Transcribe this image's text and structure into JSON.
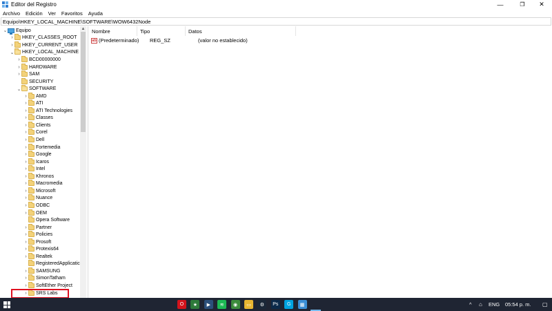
{
  "window": {
    "title": "Editor del Registro",
    "controls": {
      "minimize": "—",
      "maximize": "❐",
      "close": "✕"
    }
  },
  "menu": [
    "Archivo",
    "Edición",
    "Ver",
    "Favoritos",
    "Ayuda"
  ],
  "address": "Equipo\\HKEY_LOCAL_MACHINE\\SOFTWARE\\WOW6432Node",
  "tree": [
    {
      "label": "Equipo",
      "level": 0,
      "expanded": true,
      "icon": "computer-icon"
    },
    {
      "label": "HKEY_CLASSES_ROOT",
      "level": 1,
      "expanded": false
    },
    {
      "label": "HKEY_CURRENT_USER",
      "level": 1,
      "expanded": false
    },
    {
      "label": "HKEY_LOCAL_MACHINE",
      "level": 1,
      "expanded": true
    },
    {
      "label": "BCD00000000",
      "level": 2,
      "expanded": false
    },
    {
      "label": "HARDWARE",
      "level": 2,
      "expanded": false
    },
    {
      "label": "SAM",
      "level": 2,
      "expanded": false
    },
    {
      "label": "SECURITY",
      "level": 2,
      "expanded": null
    },
    {
      "label": "SOFTWARE",
      "level": 2,
      "expanded": true
    },
    {
      "label": "AMD",
      "level": 3,
      "expanded": false
    },
    {
      "label": "ATI",
      "level": 3,
      "expanded": false
    },
    {
      "label": "ATI Technologies",
      "level": 3,
      "expanded": false
    },
    {
      "label": "Classes",
      "level": 3,
      "expanded": false
    },
    {
      "label": "Clients",
      "level": 3,
      "expanded": false
    },
    {
      "label": "Corel",
      "level": 3,
      "expanded": false
    },
    {
      "label": "Dell",
      "level": 3,
      "expanded": false
    },
    {
      "label": "Fortemedia",
      "level": 3,
      "expanded": false
    },
    {
      "label": "Google",
      "level": 3,
      "expanded": false
    },
    {
      "label": "Icaros",
      "level": 3,
      "expanded": false
    },
    {
      "label": "Intel",
      "level": 3,
      "expanded": false
    },
    {
      "label": "Khronos",
      "level": 3,
      "expanded": false
    },
    {
      "label": "Macromedia",
      "level": 3,
      "expanded": false
    },
    {
      "label": "Microsoft",
      "level": 3,
      "expanded": false
    },
    {
      "label": "Nuance",
      "level": 3,
      "expanded": false
    },
    {
      "label": "ODBC",
      "level": 3,
      "expanded": false
    },
    {
      "label": "OEM",
      "level": 3,
      "expanded": false
    },
    {
      "label": "Opera Software",
      "level": 3,
      "expanded": null
    },
    {
      "label": "Partner",
      "level": 3,
      "expanded": false
    },
    {
      "label": "Policies",
      "level": 3,
      "expanded": false
    },
    {
      "label": "Prosoft",
      "level": 3,
      "expanded": false
    },
    {
      "label": "Protexis64",
      "level": 3,
      "expanded": false
    },
    {
      "label": "Realtek",
      "level": 3,
      "expanded": false
    },
    {
      "label": "RegisteredApplicatic",
      "level": 3,
      "expanded": null
    },
    {
      "label": "SAMSUNG",
      "level": 3,
      "expanded": false
    },
    {
      "label": "SimonTatham",
      "level": 3,
      "expanded": false
    },
    {
      "label": "SoftEther Project",
      "level": 3,
      "expanded": false
    },
    {
      "label": "SRS Labs",
      "level": 3,
      "expanded": false
    }
  ],
  "list": {
    "columns": [
      "Nombre",
      "Tipo",
      "Datos"
    ],
    "rows": [
      {
        "name": "(Predeterminado)",
        "type": "REG_SZ",
        "data": "(valor no establecido)",
        "icon_text": "ab"
      }
    ]
  },
  "taskbar": {
    "apps": [
      {
        "name": "opera-icon",
        "color": "#d3131c",
        "glyph": "O"
      },
      {
        "name": "camtasia-icon",
        "color": "#2d7a3a",
        "glyph": "★"
      },
      {
        "name": "media-player-icon",
        "color": "#2b4f7a",
        "glyph": "▶"
      },
      {
        "name": "spotify-icon",
        "color": "#1db954",
        "glyph": "≋"
      },
      {
        "name": "chrome-icon",
        "color": "#3c8c3c",
        "glyph": "◉"
      },
      {
        "name": "file-explorer-icon",
        "color": "#e8b631",
        "glyph": "▭"
      },
      {
        "name": "steam-icon",
        "color": "#1b2838",
        "glyph": "⚙"
      },
      {
        "name": "photoshop-icon",
        "color": "#0b2a4a",
        "glyph": "Ps"
      },
      {
        "name": "logitech-icon",
        "color": "#00a3e0",
        "glyph": "G"
      },
      {
        "name": "regedit-icon",
        "color": "#3b8fd6",
        "glyph": "▦"
      }
    ],
    "tray": {
      "chevron": "^",
      "language": "ENG",
      "time": "05:54 p. m."
    }
  }
}
